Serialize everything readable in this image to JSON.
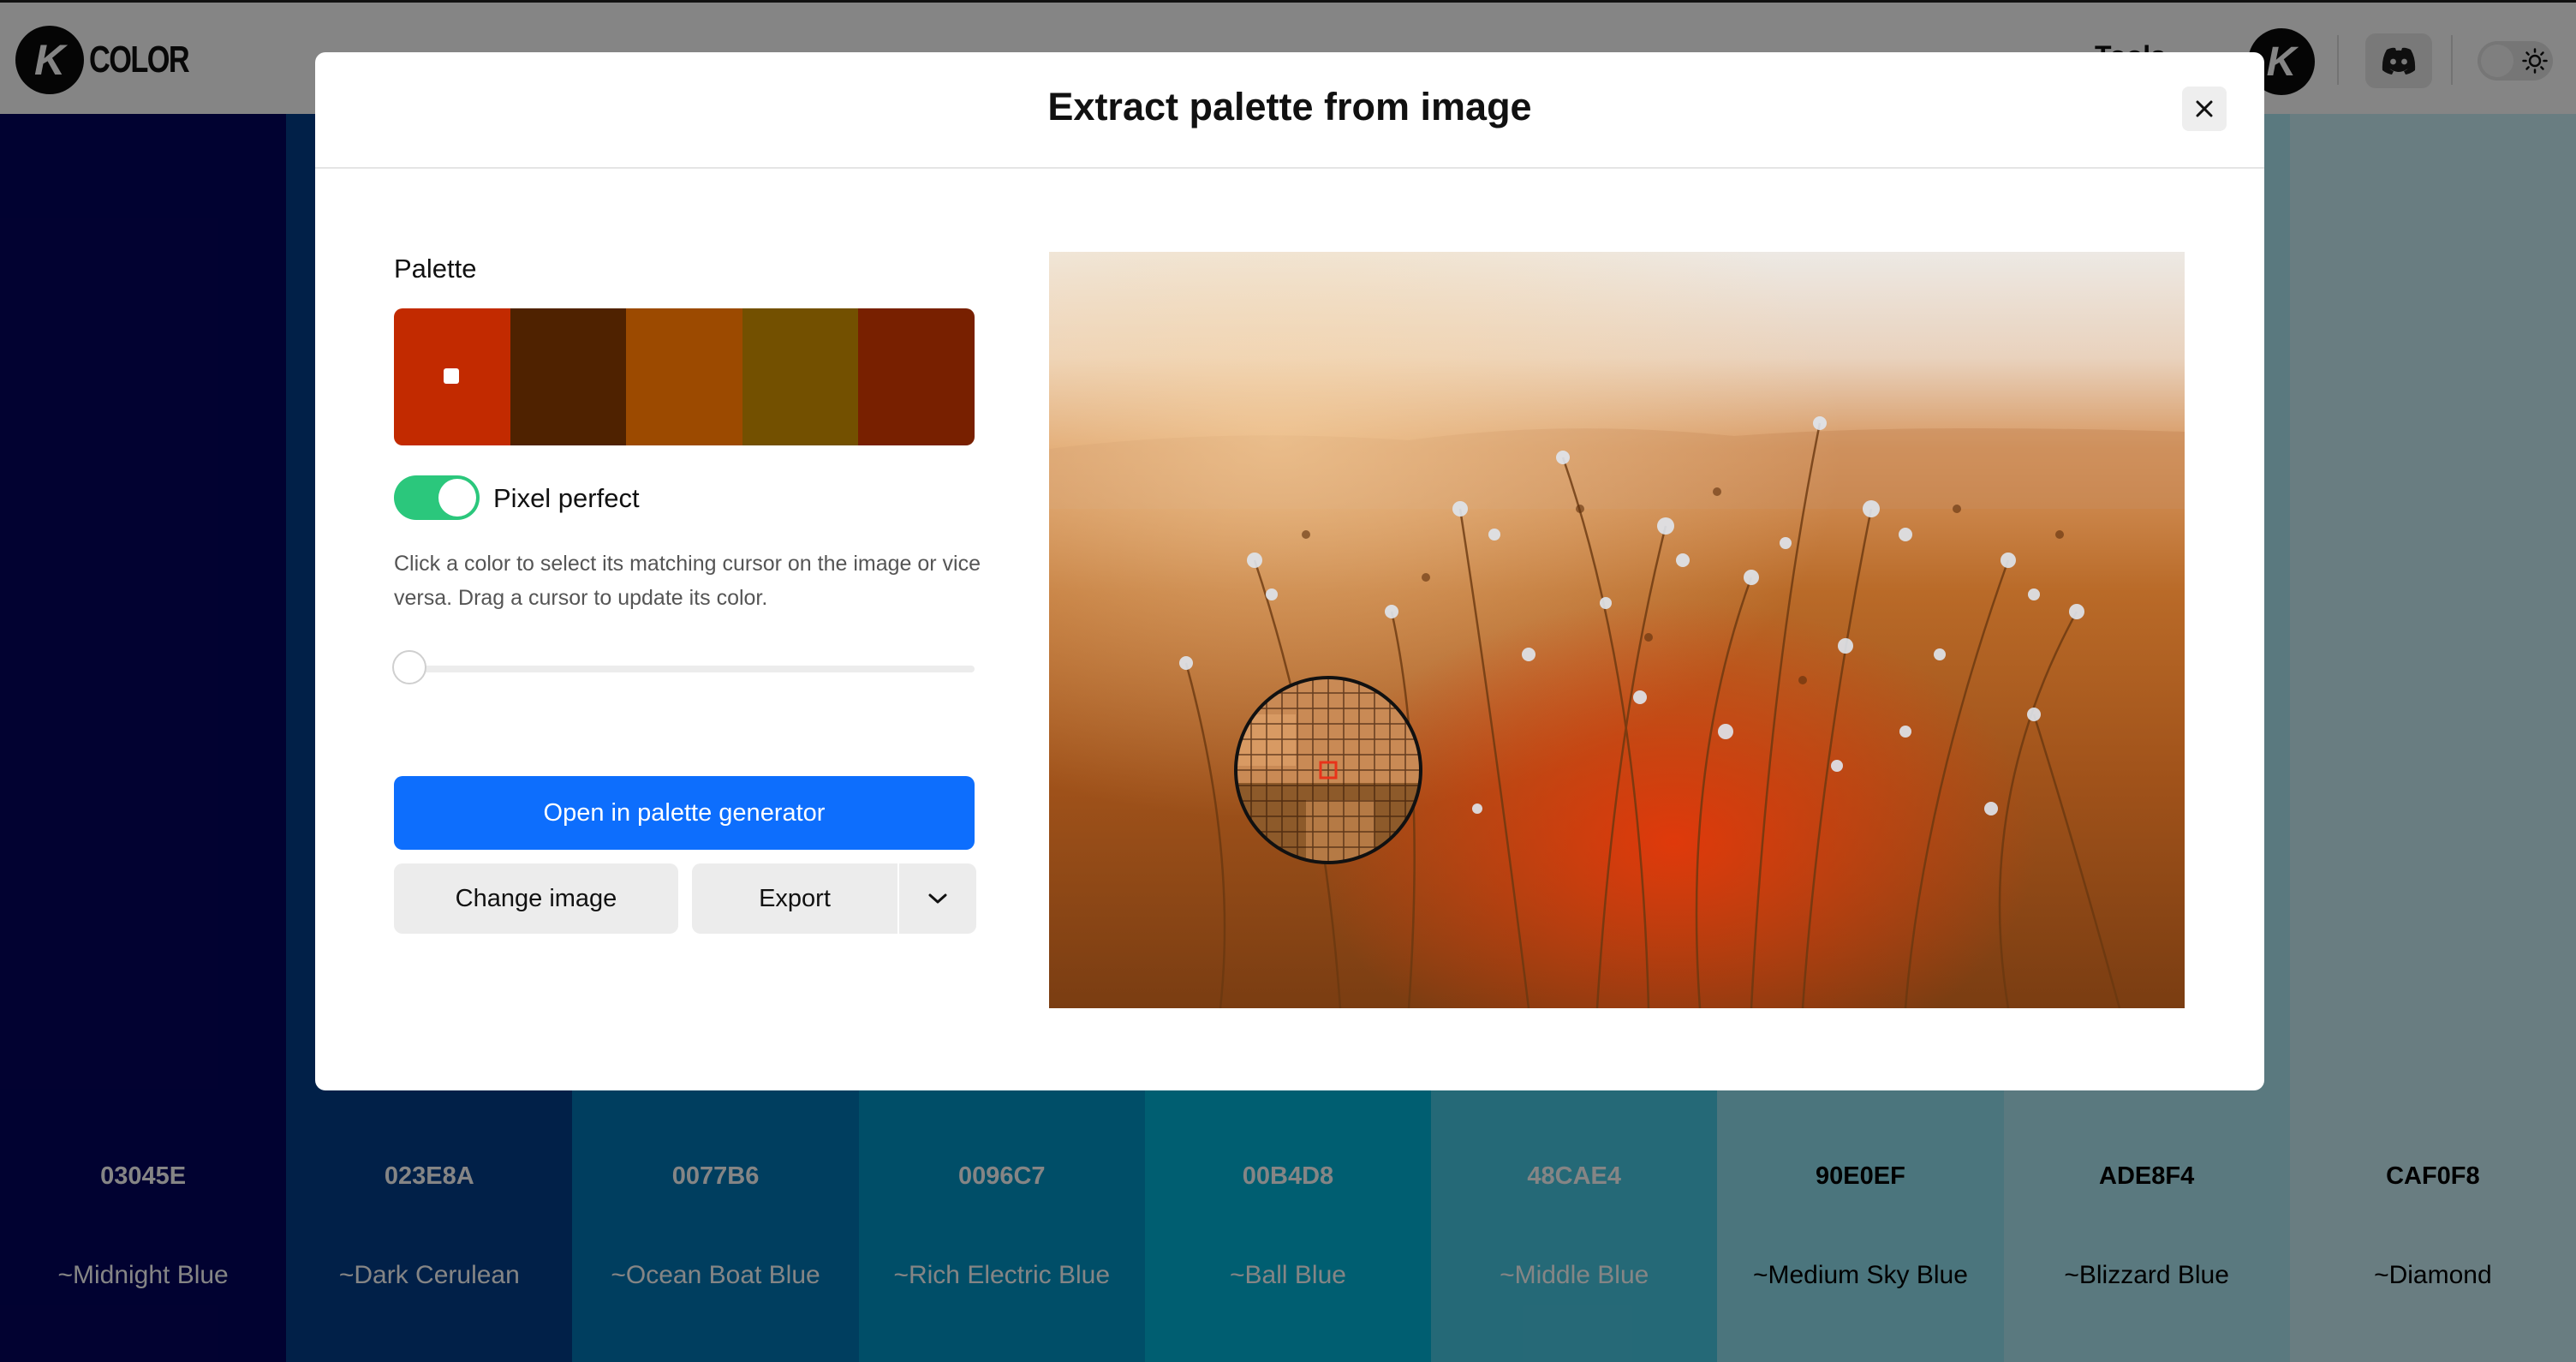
{
  "app": {
    "logo_text": "COLOR",
    "logo_mark": "K",
    "tools_label": "Tools"
  },
  "background_palette": [
    {
      "hex": "03045E",
      "name": "~Midnight Blue",
      "color": "#03045e",
      "text_color": "#ffffff"
    },
    {
      "hex": "023E8A",
      "name": "~Dark Cerulean",
      "color": "#023e8a",
      "text_color": "#ffffff"
    },
    {
      "hex": "0077B6",
      "name": "~Ocean Boat Blue",
      "color": "#0077b6",
      "text_color": "#ffffff"
    },
    {
      "hex": "0096C7",
      "name": "~Rich Electric Blue",
      "color": "#0096c7",
      "text_color": "#ffffff"
    },
    {
      "hex": "00B4D8",
      "name": "~Ball Blue",
      "color": "#00b4d8",
      "text_color": "#ffffff"
    },
    {
      "hex": "48CAE4",
      "name": "~Middle Blue",
      "color": "#48cae4",
      "text_color": "#ffffff"
    },
    {
      "hex": "90E0EF",
      "name": "~Medium Sky Blue",
      "color": "#90e0ef",
      "text_color": "#000000"
    },
    {
      "hex": "ADE8F4",
      "name": "~Blizzard Blue",
      "color": "#ade8f4",
      "text_color": "#000000"
    },
    {
      "hex": "CAF0F8",
      "name": "~Diamond",
      "color": "#caf0f8",
      "text_color": "#000000"
    }
  ],
  "modal": {
    "title": "Extract palette from image",
    "palette_label": "Palette",
    "swatches": [
      "#c22a00",
      "#4f2200",
      "#9c4a00",
      "#735000",
      "#782000"
    ],
    "pixel_perfect_label": "Pixel perfect",
    "pixel_perfect_on": true,
    "help_text": "Click a color to select its matching cursor on the image or vice versa. Drag a cursor to update its color.",
    "slider_value": 0,
    "open_button": "Open in palette generator",
    "change_image_button": "Change image",
    "export_button": "Export"
  },
  "icons": {
    "close": "close-icon",
    "caret": "chevron-down-icon",
    "discord": "discord-icon",
    "theme": "sun-icon"
  }
}
